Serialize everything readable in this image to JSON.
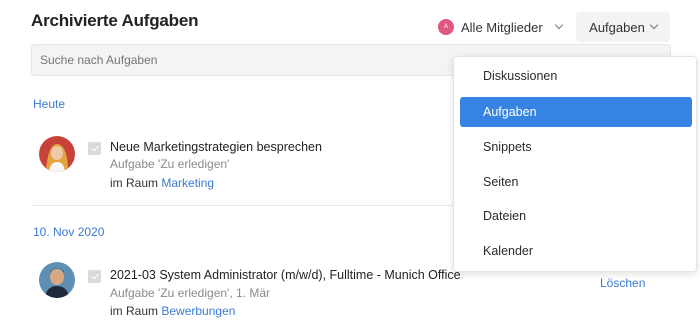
{
  "header": {
    "title": "Archivierte Aufgaben",
    "members_filter": {
      "avatar_letter": "A",
      "label": "Alle Mitglieder"
    },
    "type_filter": {
      "label": "Aufgaben"
    }
  },
  "search": {
    "placeholder": "Suche nach Aufgaben",
    "value": ""
  },
  "groups": [
    {
      "header": "Heute",
      "items": [
        {
          "title": "Neue Marketingstrategien besprechen",
          "subtitle": "Aufgabe 'Zu erledigen'",
          "room_prefix": "im Raum",
          "room": "Marketing"
        }
      ]
    },
    {
      "header": "10. Nov 2020",
      "items": [
        {
          "title": "2021-03 System Administrator (m/w/d), Fulltime - Munich Office",
          "subtitle": "Aufgabe 'Zu erledigen', 1. Mär",
          "room_prefix": "im Raum",
          "room": "Bewerbungen",
          "delete_label": "Löschen"
        }
      ]
    }
  ],
  "dropdown": {
    "items": [
      {
        "label": "Diskussionen",
        "active": false
      },
      {
        "label": "Aufgaben",
        "active": true
      },
      {
        "label": "Snippets",
        "active": false
      },
      {
        "label": "Seiten",
        "active": false
      },
      {
        "label": "Dateien",
        "active": false
      },
      {
        "label": "Kalender",
        "active": false
      }
    ]
  },
  "colors": {
    "accent": "#3584e4",
    "link": "#3a7bd5",
    "avatar_dot": "#e0577f"
  }
}
